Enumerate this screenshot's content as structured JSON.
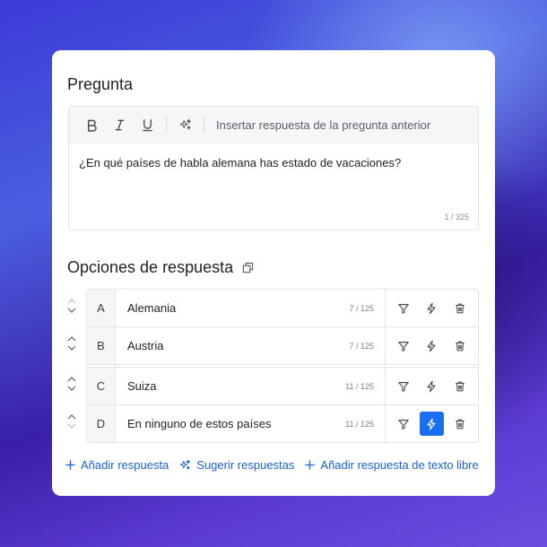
{
  "question": {
    "title": "Pregunta",
    "toolbar": {
      "bold_icon": "bold-icon",
      "italic_icon": "italic-icon",
      "underline_icon": "underline-icon",
      "ai_icon": "sparkles-icon",
      "insert_label": "Insertar respuesta de la pregunta anterior"
    },
    "text": "¿En qué países de habla alemana has estado de vacaciones?",
    "count": "1 / 325"
  },
  "options": {
    "title": "Opciones de respuesta",
    "title_icon": "copy-icon",
    "items": [
      {
        "letter": "A",
        "label": "Alemania",
        "count": "7 / 125",
        "lightning_active": false
      },
      {
        "letter": "B",
        "label": "Austria",
        "count": "7 / 125",
        "lightning_active": false
      },
      {
        "letter": "C",
        "label": "Suiza",
        "count": "11 / 125",
        "lightning_active": false
      },
      {
        "letter": "D",
        "label": "En ninguno de estos países",
        "count": "11 / 125",
        "lightning_active": true
      }
    ],
    "action_icons": [
      "filter-icon",
      "lightning-icon",
      "trash-icon"
    ]
  },
  "links": {
    "add_answer": "Añadir respuesta",
    "suggest_answers": "Sugerir respuestas",
    "add_free_text": "Añadir respuesta de texto libre"
  },
  "colors": {
    "accent": "#1a6ef0",
    "link": "#1a5fd6"
  }
}
